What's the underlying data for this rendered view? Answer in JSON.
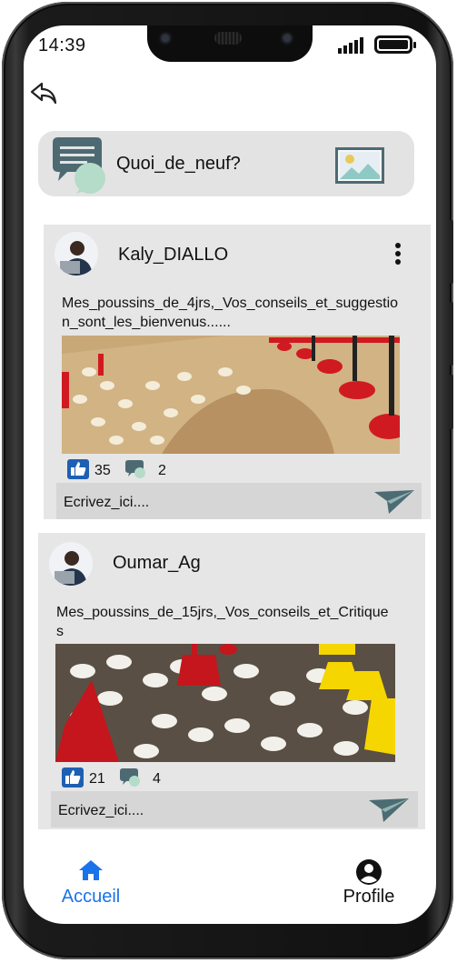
{
  "status_bar": {
    "time": "14:39"
  },
  "composer": {
    "prompt": "Quoi_de_neuf?"
  },
  "posts": [
    {
      "author": "Kaly_DIALLO",
      "text": "Mes_poussins_de_4jrs,_Vos_conseils_et_suggestion_sont_les_bienvenus......",
      "likes": "35",
      "comments": "2",
      "reply_placeholder": "Ecrivez_ici...."
    },
    {
      "author": "Oumar_Ag",
      "text": "Mes_poussins_de_15jrs,_Vos_conseils_et_Critiques",
      "likes": "21",
      "comments": "4",
      "reply_placeholder": "Ecrivez_ici...."
    }
  ],
  "bottom_nav": {
    "items": [
      {
        "label": "Accueil",
        "icon": "home-icon",
        "active": true
      },
      {
        "label": "Profile",
        "icon": "user-circle-icon",
        "active": false
      }
    ]
  },
  "colors": {
    "accent": "#1a73e8",
    "like": "#1e5fb3",
    "card": "#e6e6e6",
    "send": "#4d6b72"
  }
}
